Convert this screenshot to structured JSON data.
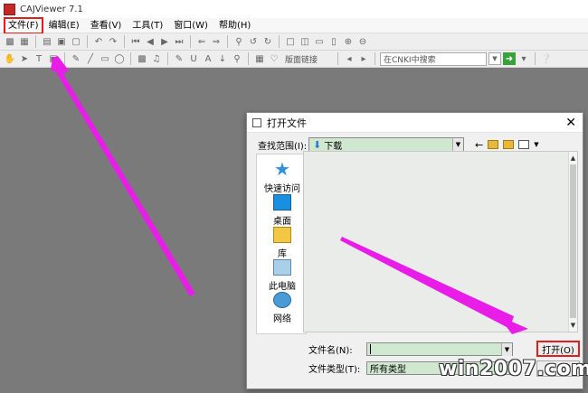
{
  "app": {
    "title": "CAJViewer 7.1"
  },
  "menu": {
    "items": [
      {
        "label": "文件(F)"
      },
      {
        "label": "编辑(E)"
      },
      {
        "label": "查看(V)"
      },
      {
        "label": "工具(T)"
      },
      {
        "label": "窗口(W)"
      },
      {
        "label": "帮助(H)"
      }
    ]
  },
  "toolbar": {
    "link_label": "版面链接",
    "search_placeholder": "在CNKI中搜索"
  },
  "dialog": {
    "title": "打开文件",
    "lookin_label": "查找范围(I):",
    "lookin_value": "下载",
    "places": [
      {
        "label": "快速访问"
      },
      {
        "label": "桌面"
      },
      {
        "label": "库"
      },
      {
        "label": "此电脑"
      },
      {
        "label": "网络"
      }
    ],
    "filename_label": "文件名(N):",
    "filename_value": "",
    "filetype_label": "文件类型(T):",
    "filetype_value": "所有类型",
    "open_label": "打开(O)"
  },
  "watermark": {
    "text": "win2007.com"
  },
  "colors": {
    "highlight": "#e11d1d",
    "annotation_arrow": "#e81ee8"
  }
}
